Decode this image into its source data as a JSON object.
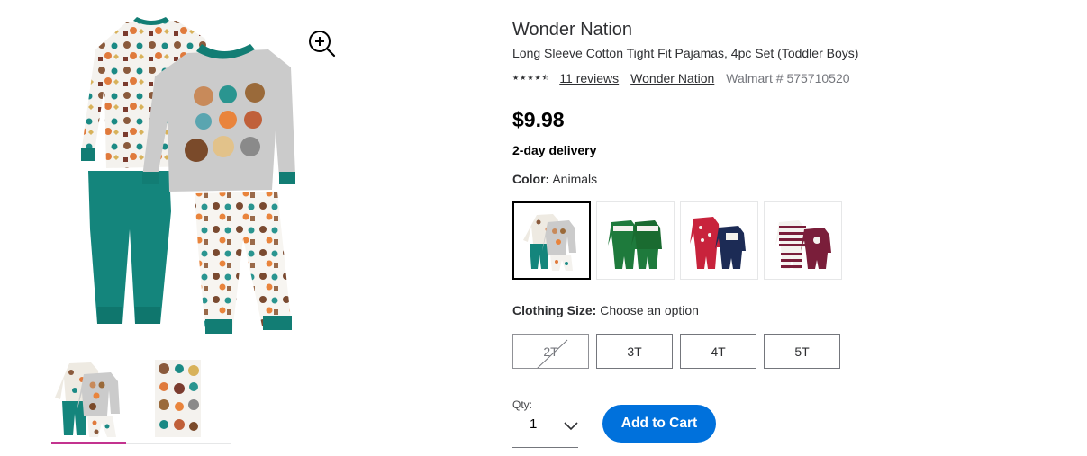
{
  "gallery": {
    "main_image_icon": "pajamas-product-image",
    "zoom_icon": "zoom-in-icon",
    "thumbnails": [
      {
        "icon": "pajamas-thumbnail",
        "active": true
      },
      {
        "icon": "print-pattern-thumbnail",
        "active": false
      }
    ],
    "active_indicator_color": "#c3338f"
  },
  "product": {
    "brand": "Wonder Nation",
    "title": "Long Sleeve Cotton Tight Fit Pajamas, 4pc Set (Toddler Boys)",
    "rating": 4.5,
    "reviews_link": "11 reviews",
    "brand_link": "Wonder Nation",
    "walmart_number": "Walmart # 575710520",
    "price": "$9.98",
    "delivery": "2-day delivery"
  },
  "color": {
    "label": "Color:",
    "value": "Animals",
    "swatches": [
      {
        "name": "animals-swatch",
        "selected": true
      },
      {
        "name": "green-swatch",
        "selected": false
      },
      {
        "name": "red-navy-swatch",
        "selected": false
      },
      {
        "name": "striped-maroon-swatch",
        "selected": false
      }
    ]
  },
  "size": {
    "label": "Clothing Size:",
    "value": "Choose an option",
    "options": [
      {
        "label": "2T",
        "available": false
      },
      {
        "label": "3T",
        "available": true
      },
      {
        "label": "4T",
        "available": true
      },
      {
        "label": "5T",
        "available": true
      }
    ]
  },
  "quantity": {
    "label": "Qty:",
    "value": "1",
    "chevron_icon": "chevron-down-icon"
  },
  "cart": {
    "button_label": "Add to Cart",
    "button_color": "#0071dc"
  }
}
